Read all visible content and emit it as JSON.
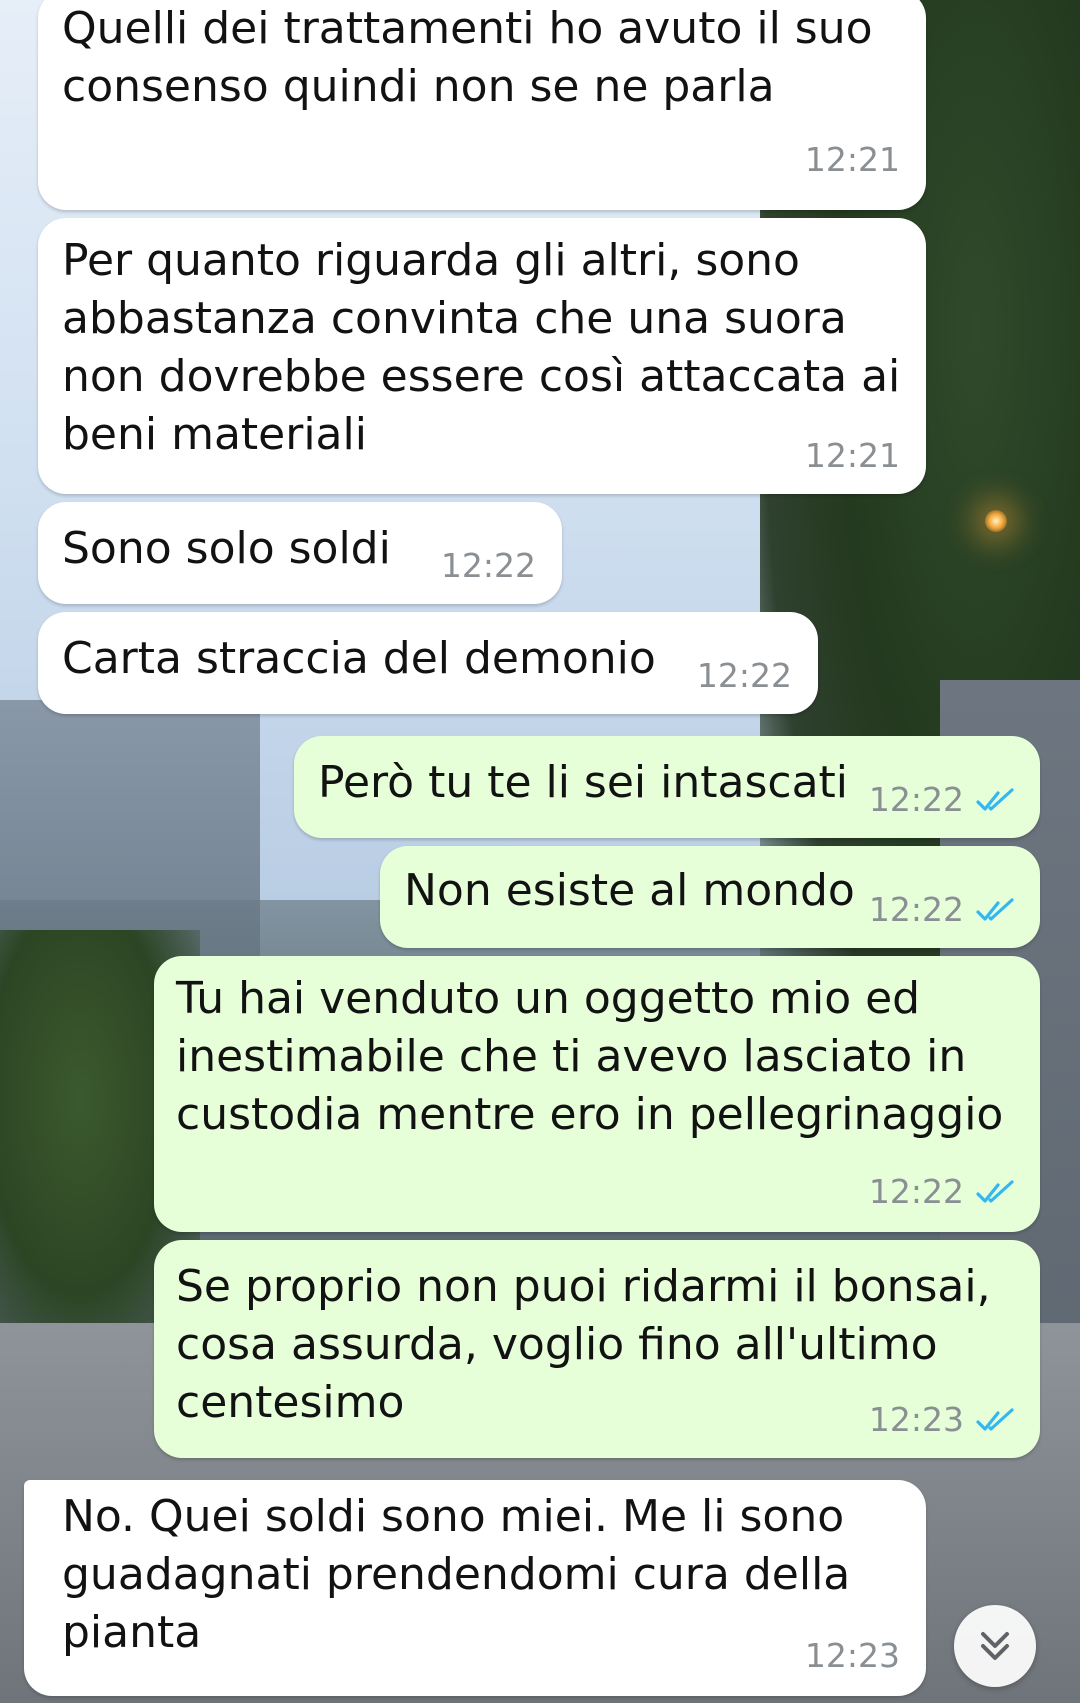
{
  "messages": [
    {
      "direction": "incoming",
      "text": [
        "Quelli dei trattamenti ho avuto il suo",
        "consenso quindi non se ne parla"
      ],
      "time": "12:21"
    },
    {
      "direction": "incoming",
      "text": [
        "Per quanto riguarda gli altri, sono",
        "abbastanza convinta che una suora",
        "non dovrebbe essere così attaccata ai",
        "beni materiali"
      ],
      "time": "12:21"
    },
    {
      "direction": "incoming",
      "text": [
        "Sono solo soldi"
      ],
      "time": "12:22"
    },
    {
      "direction": "incoming",
      "text": [
        "Carta straccia del demonio"
      ],
      "time": "12:22"
    },
    {
      "direction": "outgoing",
      "text": [
        "Però tu te li sei intascati"
      ],
      "time": "12:22",
      "status": "read"
    },
    {
      "direction": "outgoing",
      "text": [
        "Non esiste al mondo"
      ],
      "time": "12:22",
      "status": "read"
    },
    {
      "direction": "outgoing",
      "text": [
        "Tu hai venduto un oggetto mio ed",
        "inestimabile che ti avevo lasciato in",
        "custodia mentre ero in pellegrinaggio"
      ],
      "time": "12:22",
      "status": "read"
    },
    {
      "direction": "outgoing",
      "text": [
        "Se proprio non puoi ridarmi il bonsai,",
        "cosa assurda, voglio fino all'ultimo",
        "centesimo"
      ],
      "time": "12:23",
      "status": "read"
    },
    {
      "direction": "incoming",
      "text": [
        "No. Quei soldi sono miei. Me li sono",
        "guadagnati prendendomi cura della",
        "pianta"
      ],
      "time": "12:23"
    }
  ],
  "icons": {
    "read_receipt": "double-check-icon",
    "scroll_down": "chevron-double-down-icon"
  },
  "colors": {
    "incoming_bubble": "#ffffff",
    "outgoing_bubble": "#e6ffd9",
    "timestamp": "#8a8f93",
    "read_tick": "#34b7f1"
  }
}
